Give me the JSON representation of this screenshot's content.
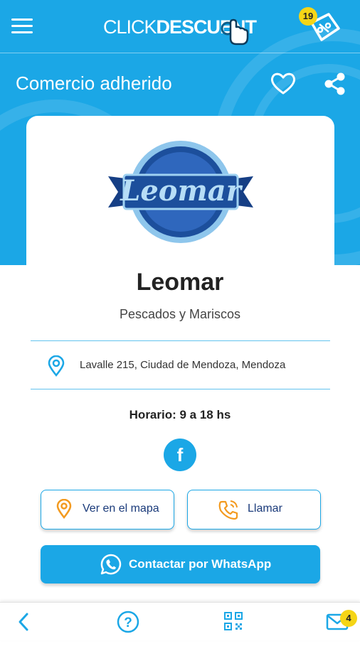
{
  "header": {
    "brand_left": "CLICK",
    "brand_right": "DESCUENT",
    "coupon_badge": "19"
  },
  "page": {
    "title": "Comercio adherido"
  },
  "merchant": {
    "logo_text": "Leomar",
    "name": "Leomar",
    "category": "Pescados y Mariscos",
    "address": "Lavalle 215, Ciudad de Mendoza, Mendoza",
    "hours": "Horario: 9 a 18 hs"
  },
  "actions": {
    "map_label": "Ver en el mapa",
    "call_label": "Llamar",
    "whatsapp_label": "Contactar por WhatsApp",
    "facebook_glyph": "f"
  },
  "bottom_nav": {
    "mail_badge": "4"
  },
  "colors": {
    "primary": "#1ba7e6",
    "accent_orange": "#f39a1f",
    "badge_yellow": "#f5d516",
    "button_text_dark": "#1a3a7a"
  },
  "icons": [
    "menu-icon",
    "hand-pointer-icon",
    "coupon-icon",
    "heart-icon",
    "share-icon",
    "location-pin-icon",
    "facebook-icon",
    "phone-icon",
    "whatsapp-icon",
    "back-chevron-icon",
    "help-icon",
    "qr-code-icon",
    "mail-icon"
  ]
}
